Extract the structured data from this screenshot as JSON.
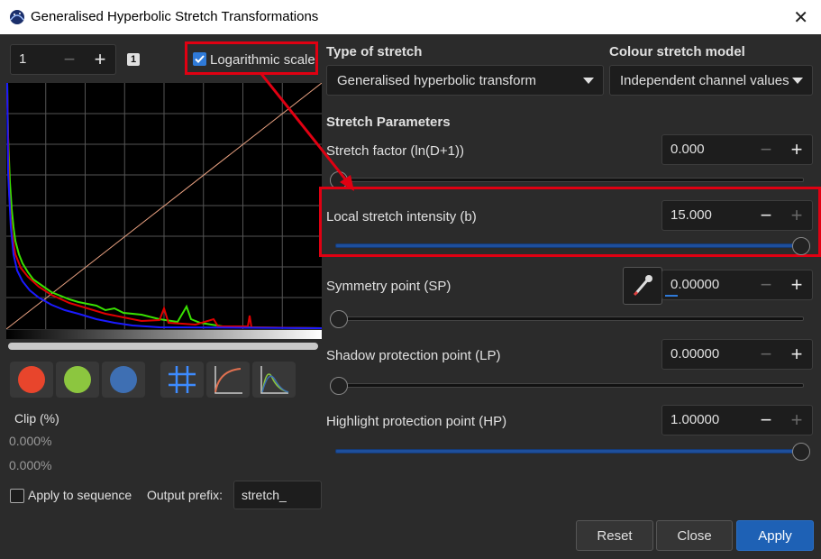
{
  "window": {
    "title": "Generalised Hyperbolic Stretch Transformations",
    "close_glyph": "✕"
  },
  "histogram_toolbar": {
    "zoom_value": "1",
    "minus": "−",
    "plus": "+",
    "badge": "1",
    "log_scale_label": "Logarithmic scale",
    "log_scale_checked": true
  },
  "channels": [
    {
      "name": "red-channel",
      "color": "#e8452c"
    },
    {
      "name": "green-channel",
      "color": "#8cc63f"
    },
    {
      "name": "blue-channel",
      "color": "#3e6fb3"
    }
  ],
  "view_tools": [
    "grid-icon",
    "curve-icon",
    "histogram-icon"
  ],
  "clip": {
    "label": "Clip (%)",
    "low": "0.000%",
    "high": "0.000%"
  },
  "sequence": {
    "label": "Apply to sequence",
    "prefix_label": "Output prefix:",
    "prefix_value": "stretch_"
  },
  "stretch_type": {
    "label": "Type of stretch",
    "value": "Generalised hyperbolic transform"
  },
  "colour_model": {
    "label": "Colour stretch model",
    "value": "Independent channel values"
  },
  "params_heading": "Stretch Parameters",
  "params": {
    "stretch_factor": {
      "label": "Stretch factor (ln(D+1))",
      "value": "0.000",
      "slider": 0.0
    },
    "local_intensity": {
      "label": "Local stretch intensity (b)",
      "value": "15.000",
      "slider": 1.0
    },
    "symmetry_point": {
      "label": "Symmetry point (SP)",
      "value": "0.00000",
      "slider": 0.0
    },
    "shadow_protection": {
      "label": "Shadow protection point (LP)",
      "value": "0.00000",
      "slider": 0.0
    },
    "highlight_protection": {
      "label": "Highlight protection point (HP)",
      "value": "1.00000",
      "slider": 1.0
    }
  },
  "buttons": {
    "reset": "Reset",
    "close": "Close",
    "apply": "Apply"
  },
  "colors": {
    "accent": "#1e61b5",
    "highlight_box": "#e00012",
    "background": "#2b2b2b"
  }
}
